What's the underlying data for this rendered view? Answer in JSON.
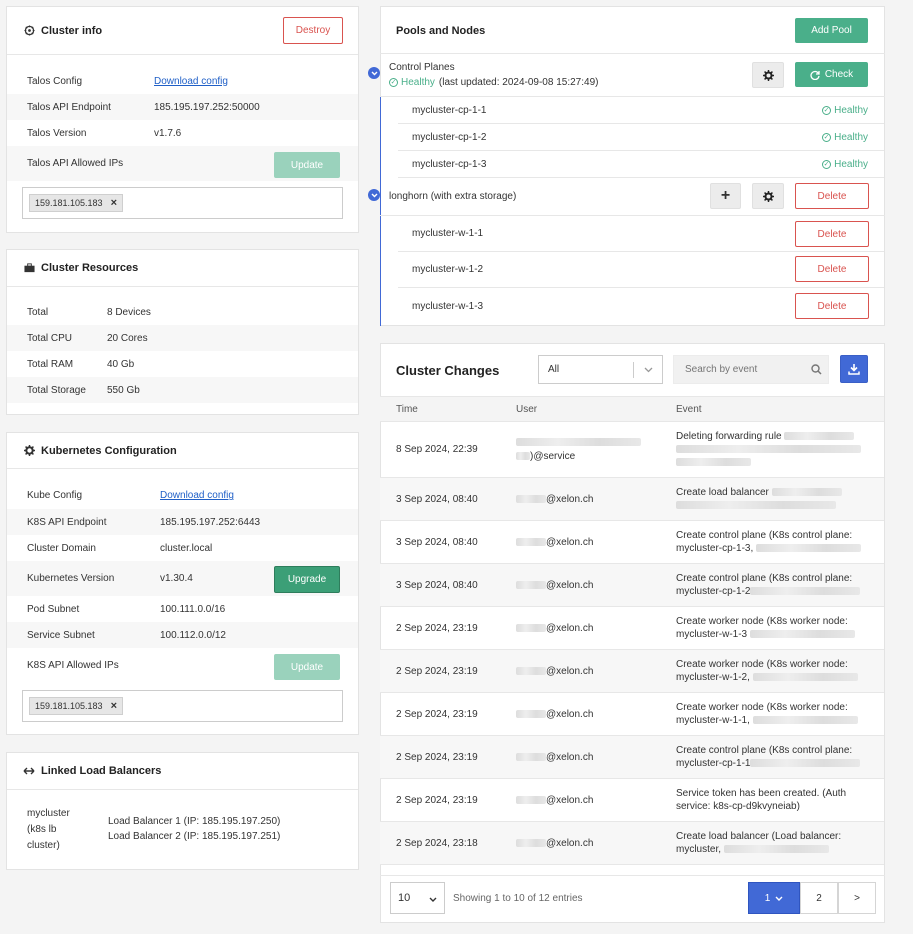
{
  "cluster_info": {
    "title": "Cluster info",
    "destroy_label": "Destroy",
    "rows": [
      {
        "key": "Talos Config",
        "value": "Download config"
      },
      {
        "key": "Talos API Endpoint",
        "value": "185.195.197.252:50000"
      },
      {
        "key": "Talos Version",
        "value": "v1.7.6"
      }
    ],
    "allowed_ips_label": "Talos API Allowed IPs",
    "update_label": "Update",
    "ip_chip": "159.181.105.183"
  },
  "resources": {
    "title": "Cluster Resources",
    "rows": [
      {
        "key": "Total",
        "value": "8 Devices"
      },
      {
        "key": "Total CPU",
        "value": "20 Cores"
      },
      {
        "key": "Total RAM",
        "value": "40 Gb"
      },
      {
        "key": "Total Storage",
        "value": "550 Gb"
      }
    ]
  },
  "k8s": {
    "title": "Kubernetes Configuration",
    "rows": [
      {
        "key": "Kube Config",
        "value": "Download config"
      },
      {
        "key": "K8S API Endpoint",
        "value": "185.195.197.252:6443"
      },
      {
        "key": "Cluster Domain",
        "value": "cluster.local"
      },
      {
        "key": "Kubernetes Version",
        "value": "v1.30.4"
      },
      {
        "key": "Pod Subnet",
        "value": "100.111.0.0/16"
      },
      {
        "key": "Service Subnet",
        "value": "100.112.0.0/12"
      }
    ],
    "upgrade_label": "Upgrade",
    "allowed_ips_label": "K8S API Allowed IPs",
    "update_label": "Update",
    "ip_chip": "159.181.105.183"
  },
  "load_balancers": {
    "title": "Linked Load Balancers",
    "name_lines": [
      "mycluster",
      "(k8s lb",
      "cluster)"
    ],
    "items": [
      "Load Balancer 1 (IP: 185.195.197.250)",
      "Load Balancer 2 (IP: 185.195.197.251)"
    ]
  },
  "pools": {
    "title": "Pools and Nodes",
    "add_pool_label": "Add Pool",
    "control_planes": {
      "name": "Control Planes",
      "status": "Healthy",
      "last_updated": "(last updated: 2024-09-08 15:27:49)",
      "check_label": "Check",
      "nodes": [
        {
          "name": "mycluster-cp-1-1",
          "status": "Healthy"
        },
        {
          "name": "mycluster-cp-1-2",
          "status": "Healthy"
        },
        {
          "name": "mycluster-cp-1-3",
          "status": "Healthy"
        }
      ]
    },
    "worker_pool": {
      "name": "longhorn (with extra storage)",
      "delete_label": "Delete",
      "nodes": [
        {
          "name": "mycluster-w-1-1",
          "action": "Delete"
        },
        {
          "name": "mycluster-w-1-2",
          "action": "Delete"
        },
        {
          "name": "mycluster-w-1-3",
          "action": "Delete"
        }
      ]
    }
  },
  "changes": {
    "title": "Cluster Changes",
    "filter_value": "All",
    "search_placeholder": "Search by event",
    "columns": [
      "Time",
      "User",
      "Event"
    ],
    "rows": [
      {
        "time": "8 Sep 2024, 22:39",
        "user": ")@service",
        "event": "Deleting forwarding rule"
      },
      {
        "time": "3 Sep 2024, 08:40",
        "user": "@xelon.ch",
        "event": "Create load balancer"
      },
      {
        "time": "3 Sep 2024, 08:40",
        "user": "@xelon.ch",
        "event": "Create control plane (K8s control plane:",
        "event2": "mycluster-cp-1-3,"
      },
      {
        "time": "3 Sep 2024, 08:40",
        "user": "@xelon.ch",
        "event": "Create control plane (K8s control plane:",
        "event2": "mycluster-cp-1-2"
      },
      {
        "time": "2 Sep 2024, 23:19",
        "user": "@xelon.ch",
        "event": "Create worker node (K8s worker node:",
        "event2": "mycluster-w-1-3"
      },
      {
        "time": "2 Sep 2024, 23:19",
        "user": "@xelon.ch",
        "event": "Create worker node (K8s worker node:",
        "event2": "mycluster-w-1-2,"
      },
      {
        "time": "2 Sep 2024, 23:19",
        "user": "@xelon.ch",
        "event": "Create worker node (K8s worker node:",
        "event2": "mycluster-w-1-1,"
      },
      {
        "time": "2 Sep 2024, 23:19",
        "user": "@xelon.ch",
        "event": "Create control plane (K8s control plane:",
        "event2": "mycluster-cp-1-1"
      },
      {
        "time": "2 Sep 2024, 23:19",
        "user": "@xelon.ch",
        "event": "Service token has been created. (Auth",
        "event2": "service: k8s-cp-d9kvyneiab)"
      },
      {
        "time": "2 Sep 2024, 23:18",
        "user": "@xelon.ch",
        "event": "Create load balancer (Load balancer:",
        "event2": "mycluster,"
      }
    ],
    "page_size": "10",
    "showing": "Showing 1 to 10 of 12 entries",
    "pages": [
      "1",
      "2",
      ">"
    ]
  }
}
